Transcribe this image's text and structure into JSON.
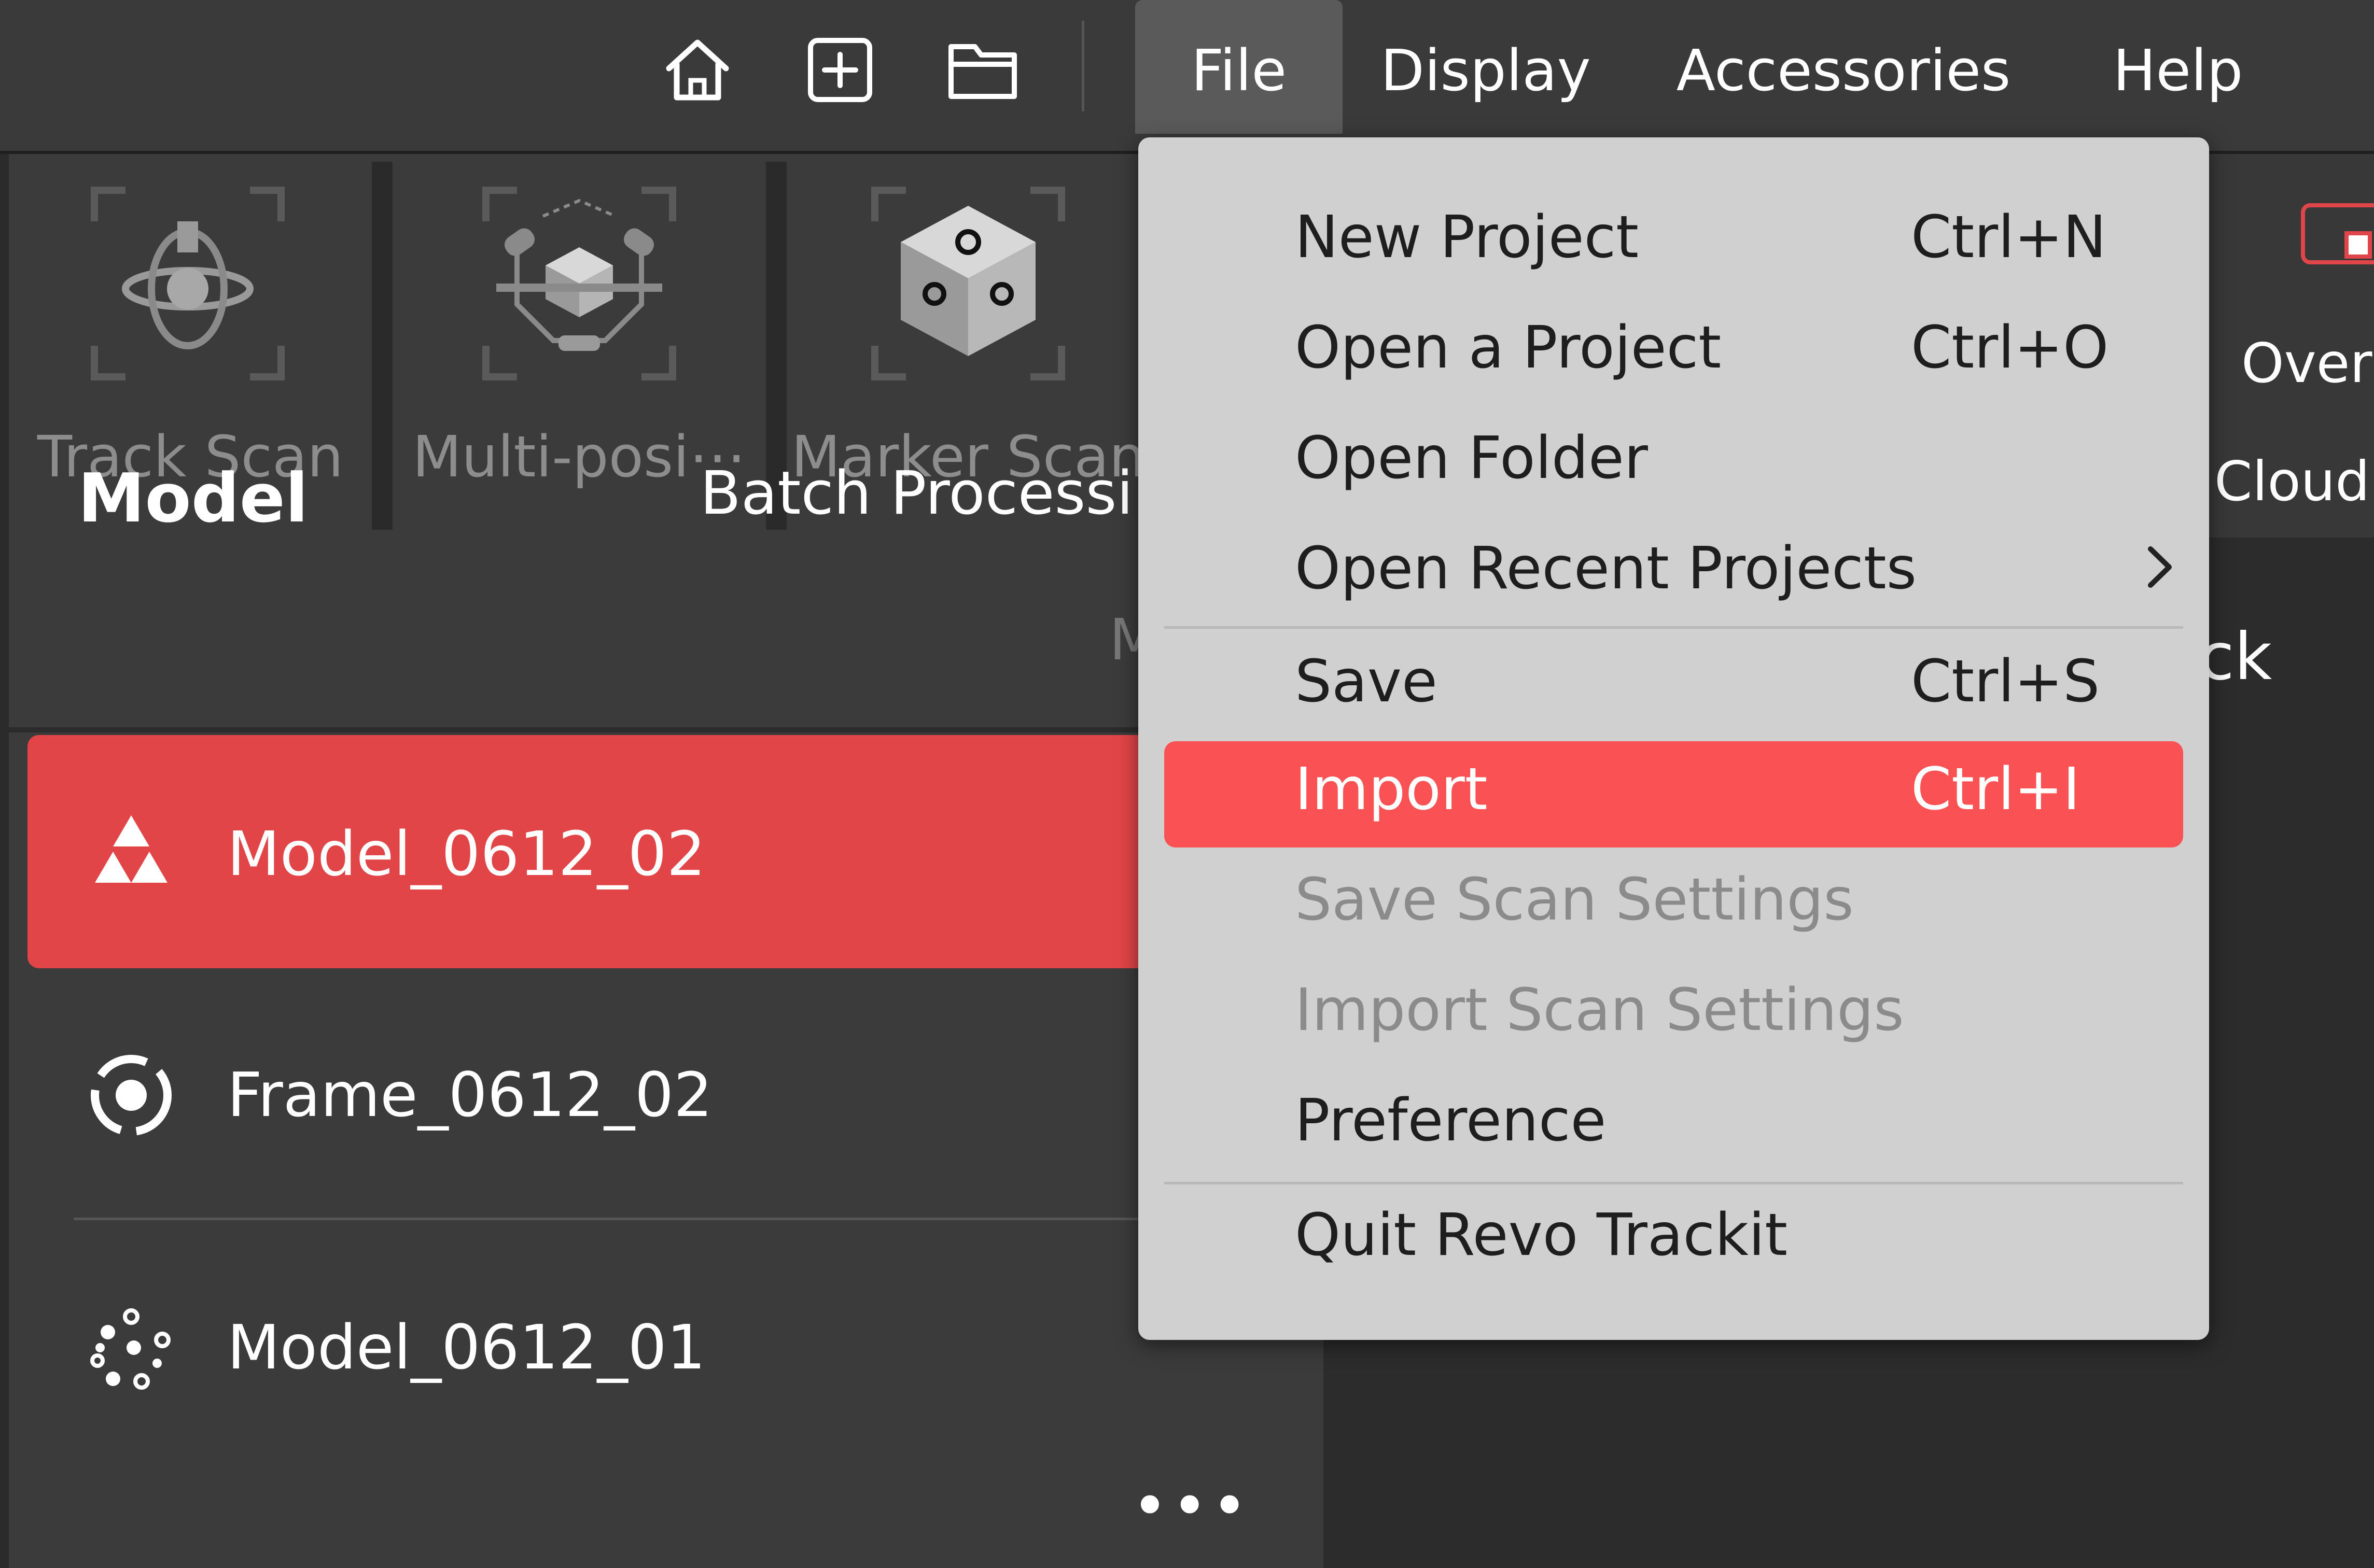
{
  "toolbar": {
    "icons": [
      "home-icon",
      "new-project-icon",
      "open-folder-icon"
    ],
    "menus": [
      "File",
      "Display",
      "Accessories",
      "Help"
    ]
  },
  "scan_modes": [
    {
      "label": "Track Scan",
      "icon": "track-scan-icon"
    },
    {
      "label": "Multi-posi⋯",
      "icon": "multi-position-scan-icon"
    },
    {
      "label": "Marker Scan",
      "icon": "marker-scan-icon"
    }
  ],
  "panel_tabs": {
    "model": "Model",
    "batch": "Batch Processing",
    "sub_partial": "M"
  },
  "models": [
    {
      "name": "Model_0612_02",
      "icon": "model-triangle-icon",
      "selected": true
    },
    {
      "name": "Frame_0612_02",
      "icon": "frame-icon",
      "selected": false
    },
    {
      "name": "Model_0612_01",
      "icon": "point-cloud-icon",
      "selected": false
    }
  ],
  "more_label": "•••",
  "right_panel": {
    "overl": "Overl",
    "cloud": "Cloud",
    "ck": "ck",
    "accent": "#e0454a"
  },
  "file_menu": {
    "items": [
      {
        "label": "New Project",
        "shortcut": "Ctrl+N"
      },
      {
        "label": "Open a Project",
        "shortcut": "Ctrl+O"
      },
      {
        "label": "Open Folder",
        "shortcut": ""
      },
      {
        "label": "Open Recent Projects",
        "shortcut": "",
        "submenu": true
      },
      {
        "label": "Save",
        "shortcut": "Ctrl+S"
      },
      {
        "label": "Import",
        "shortcut": "Ctrl+I",
        "highlighted": true
      },
      {
        "label": "Save Scan Settings",
        "shortcut": "",
        "disabled": true
      },
      {
        "label": "Import Scan Settings",
        "shortcut": "",
        "disabled": true
      },
      {
        "label": "Preference",
        "shortcut": ""
      },
      {
        "label": "Quit Revo Trackit",
        "shortcut": ""
      }
    ]
  },
  "colors": {
    "highlight": "#fa5254",
    "selected_row": "#e24548",
    "menu_bg": "#d0d0d0"
  }
}
